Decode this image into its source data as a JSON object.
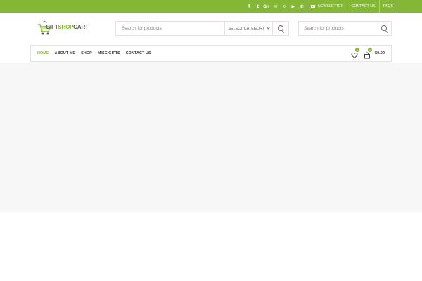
{
  "topbar": {
    "social": [
      {
        "icon": "facebook-icon",
        "glyph": "f"
      },
      {
        "icon": "twitter-icon",
        "glyph": "t"
      },
      {
        "icon": "google-plus-icon",
        "glyph": "G+"
      },
      {
        "icon": "email-icon",
        "glyph": "✉"
      },
      {
        "icon": "instagram-icon",
        "glyph": "◎"
      },
      {
        "icon": "youtube-icon",
        "glyph": "▶"
      },
      {
        "icon": "pinterest-icon",
        "glyph": "℗"
      }
    ],
    "links": {
      "newsletter": "NEWSLETTER",
      "contact": "CONTACT US",
      "faqs": "FAQS"
    }
  },
  "header": {
    "logo": {
      "part1": "GIFT",
      "part2": "SHOP",
      "part3": "CART"
    },
    "search_main": {
      "placeholder": "Search for products",
      "category": "SELECT CATEGORY"
    },
    "search_secondary": {
      "placeholder": "Search for products"
    }
  },
  "nav": {
    "items": [
      "HOME",
      "ABOUT ME",
      "SHOP",
      "MISC GIFTS",
      "CONTACT US"
    ],
    "wishlist_count": "0",
    "cart_count": "0",
    "cart_total": "$0.00"
  },
  "colors": {
    "accent": "#83b735",
    "hero_bg": "#f7f7f7"
  }
}
